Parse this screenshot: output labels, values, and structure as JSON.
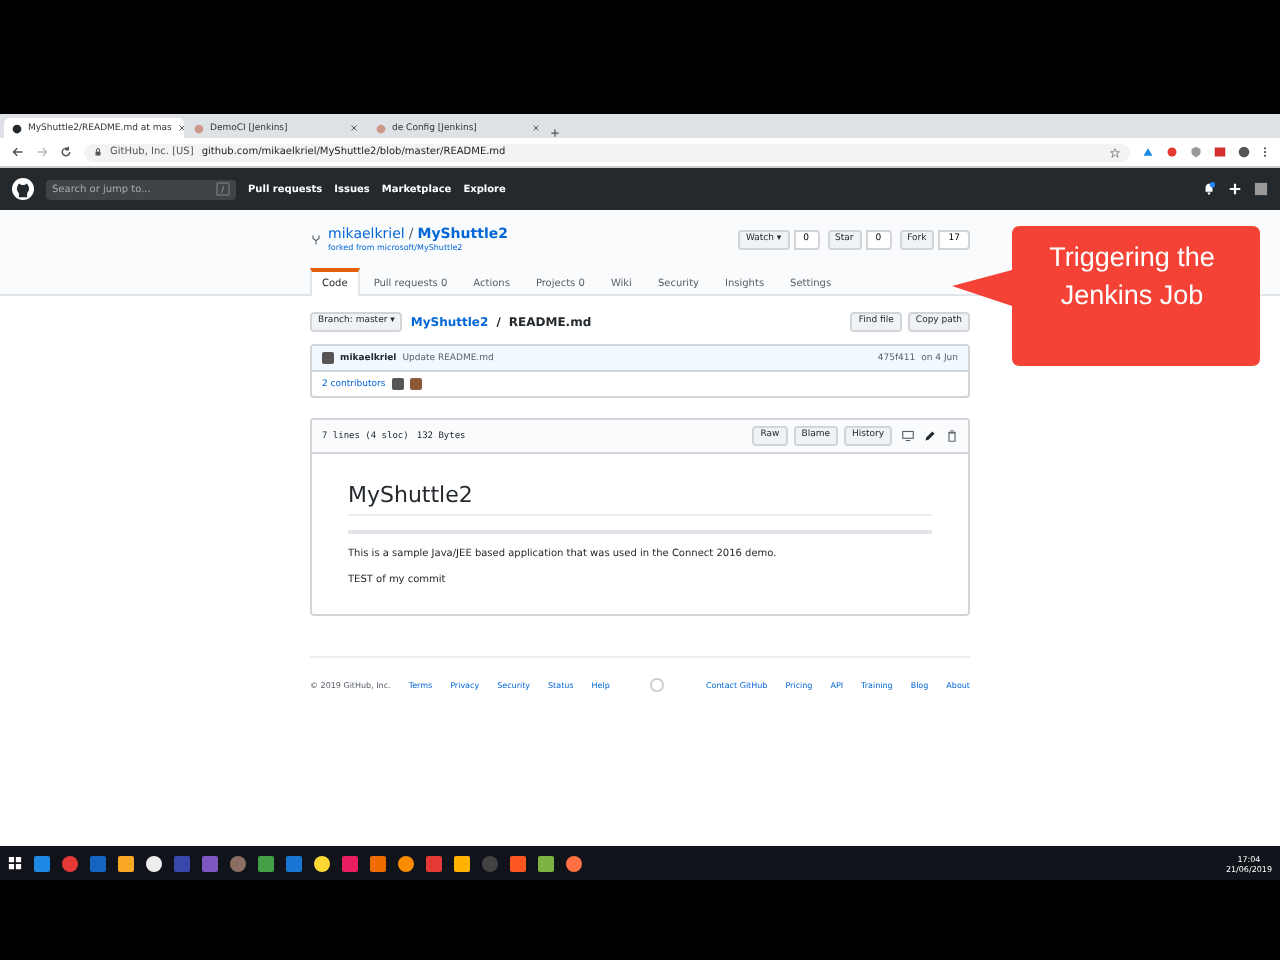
{
  "browser": {
    "tabs": [
      {
        "title": "MyShuttle2/README.md at mas",
        "selected": true
      },
      {
        "title": "DemoCI [Jenkins]",
        "selected": false
      },
      {
        "title": "de Config [Jenkins]",
        "selected": false
      }
    ],
    "address": {
      "site": "GitHub, Inc. [US]",
      "url": "github.com/mikaelkriel/MyShuttle2/blob/master/README.md"
    }
  },
  "header": {
    "search": {
      "placeholder": "Search or jump to...",
      "key": "/"
    },
    "nav": [
      "Pull requests",
      "Issues",
      "Marketplace",
      "Explore"
    ]
  },
  "repo": {
    "owner": "mikaelkriel",
    "separator": "/",
    "name": "MyShuttle2",
    "forked_from": "forked from microsoft/MyShuttle2",
    "actions": [
      {
        "label": "Watch ▾",
        "count": "0"
      },
      {
        "label": "Star",
        "count": "0"
      },
      {
        "label": "Fork",
        "count": "17"
      }
    ],
    "tabs": [
      {
        "label": "Code",
        "selected": true
      },
      {
        "label": "Pull requests",
        "count": "0",
        "selected": false
      },
      {
        "label": "Actions",
        "selected": false
      },
      {
        "label": "Projects",
        "count": "0",
        "selected": false
      },
      {
        "label": "Wiki",
        "selected": false
      },
      {
        "label": "Security",
        "selected": false
      },
      {
        "label": "Insights",
        "selected": false
      },
      {
        "label": "Settings",
        "selected": false
      }
    ]
  },
  "file_nav": {
    "branch": "Branch: master ▾",
    "path_repo": "MyShuttle2",
    "path_sep": "/",
    "path_file": "README.md",
    "buttons": [
      "Find file",
      "Copy path"
    ]
  },
  "commit": {
    "author": "mikaelkriel",
    "message": "Update README.md",
    "sha": "475f411",
    "date": "on 4 Jun",
    "contributors": "2 contributors"
  },
  "file": {
    "lines": "7 lines (4 sloc)",
    "size": "132 Bytes",
    "buttons": [
      "Raw",
      "Blame",
      "History"
    ],
    "heading": "MyShuttle2",
    "paragraphs": [
      "This is a sample Java/JEE based application that was used in the Connect 2016 demo.",
      "TEST of my commit"
    ]
  },
  "footer": {
    "left": [
      "© 2019 GitHub, Inc.",
      "Terms",
      "Privacy",
      "Security",
      "Status",
      "Help"
    ],
    "right": [
      "Contact GitHub",
      "Pricing",
      "API",
      "Training",
      "Blog",
      "About"
    ]
  },
  "callout": {
    "text": "Triggering the Jenkins Job"
  },
  "taskbar": {
    "time": "17:04",
    "date": "21/06/2019"
  }
}
